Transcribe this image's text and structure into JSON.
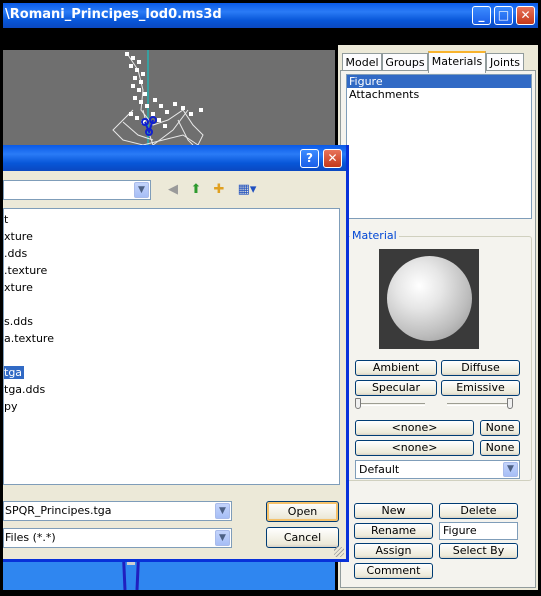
{
  "window": {
    "title": "\\Romani_Principes_lod0.ms3d",
    "minimize_glyph": "_",
    "maximize_glyph": "□",
    "close_glyph": "✕"
  },
  "tabs": [
    {
      "label": "Model"
    },
    {
      "label": "Groups"
    },
    {
      "label": "Materials"
    },
    {
      "label": "Joints"
    }
  ],
  "materials_panel": {
    "list": [
      "Figure",
      "Attachments"
    ],
    "selected": "Figure",
    "group_label": "Material",
    "buttons": {
      "ambient": "Ambient",
      "diffuse": "Diffuse",
      "specular": "Specular",
      "emissive": "Emissive",
      "texture1": "<none>",
      "texture1_clear": "None",
      "texture2": "<none>",
      "texture2_clear": "None"
    },
    "mode_select": "Default",
    "actions": {
      "new": "New",
      "delete": "Delete",
      "rename": "Rename",
      "assign": "Assign",
      "select_by": "Select By",
      "comment": "Comment"
    },
    "name_value": "Figure"
  },
  "open_dialog": {
    "help_glyph": "?",
    "close_glyph": "✕",
    "files": [
      "t",
      "xture",
      ".dds",
      ".texture",
      "xture",
      "",
      "s.dds",
      "a.texture",
      "",
      "tga",
      "tga.dds",
      "py"
    ],
    "selected_file": "tga",
    "filename_value": "SPQR_Principes.tga",
    "filetype_value": "Files (*.*)",
    "open_label": "Open",
    "cancel_label": "Cancel"
  },
  "colors": {
    "title_blue": "#0a5ae8",
    "selection": "#316ac5",
    "viewport_gray": "#6f6f6f",
    "viewport_floor": "#2f86f0",
    "group_legend": "#0046d5"
  }
}
